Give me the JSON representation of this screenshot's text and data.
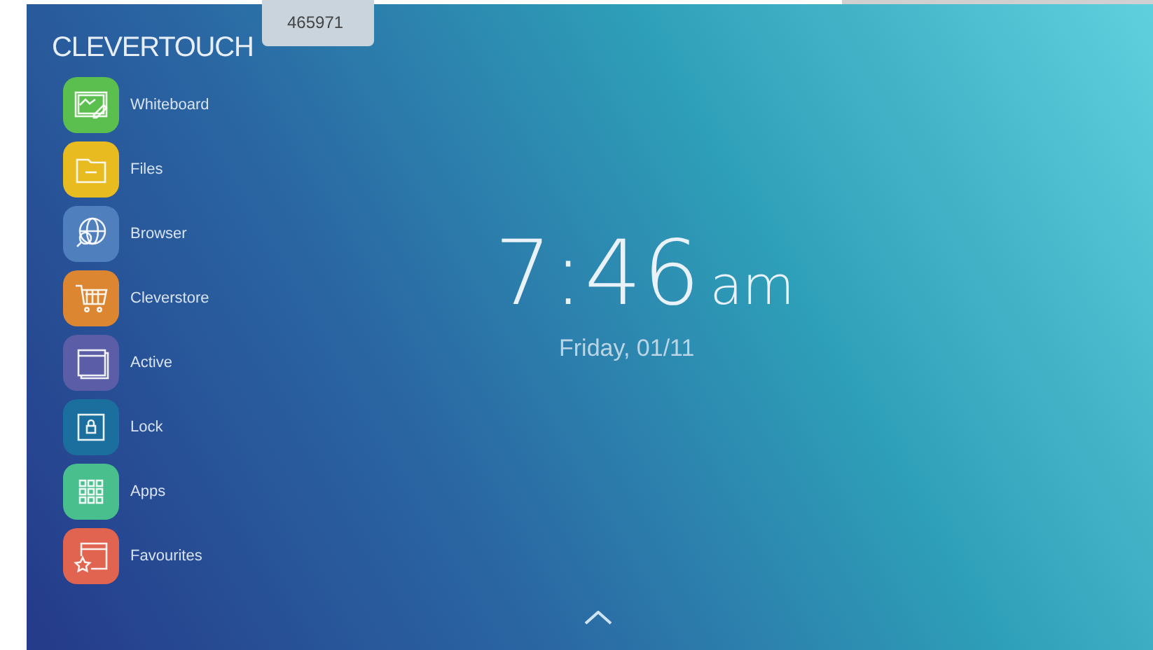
{
  "header": {
    "logo": "CLEVERTOUCH",
    "badge": "465971"
  },
  "sidebar": {
    "items": [
      {
        "label": "Whiteboard",
        "kind": "whiteboard",
        "color": "#5bbf4f"
      },
      {
        "label": "Files",
        "kind": "files",
        "color": "#e8bb21"
      },
      {
        "label": "Browser",
        "kind": "browser",
        "color": "#4f7fbd"
      },
      {
        "label": "Cleverstore",
        "kind": "store",
        "color": "#dd8631"
      },
      {
        "label": "Active",
        "kind": "active",
        "color": "#5b5ea6"
      },
      {
        "label": "Lock",
        "kind": "lock",
        "color": "#1b6f9e"
      },
      {
        "label": "Apps",
        "kind": "apps",
        "color": "#48bf8c"
      },
      {
        "label": "Favourites",
        "kind": "favourites",
        "color": "#e0644f"
      }
    ]
  },
  "clock": {
    "time": "7:46",
    "period": "am",
    "date": "Friday, 01/11"
  }
}
